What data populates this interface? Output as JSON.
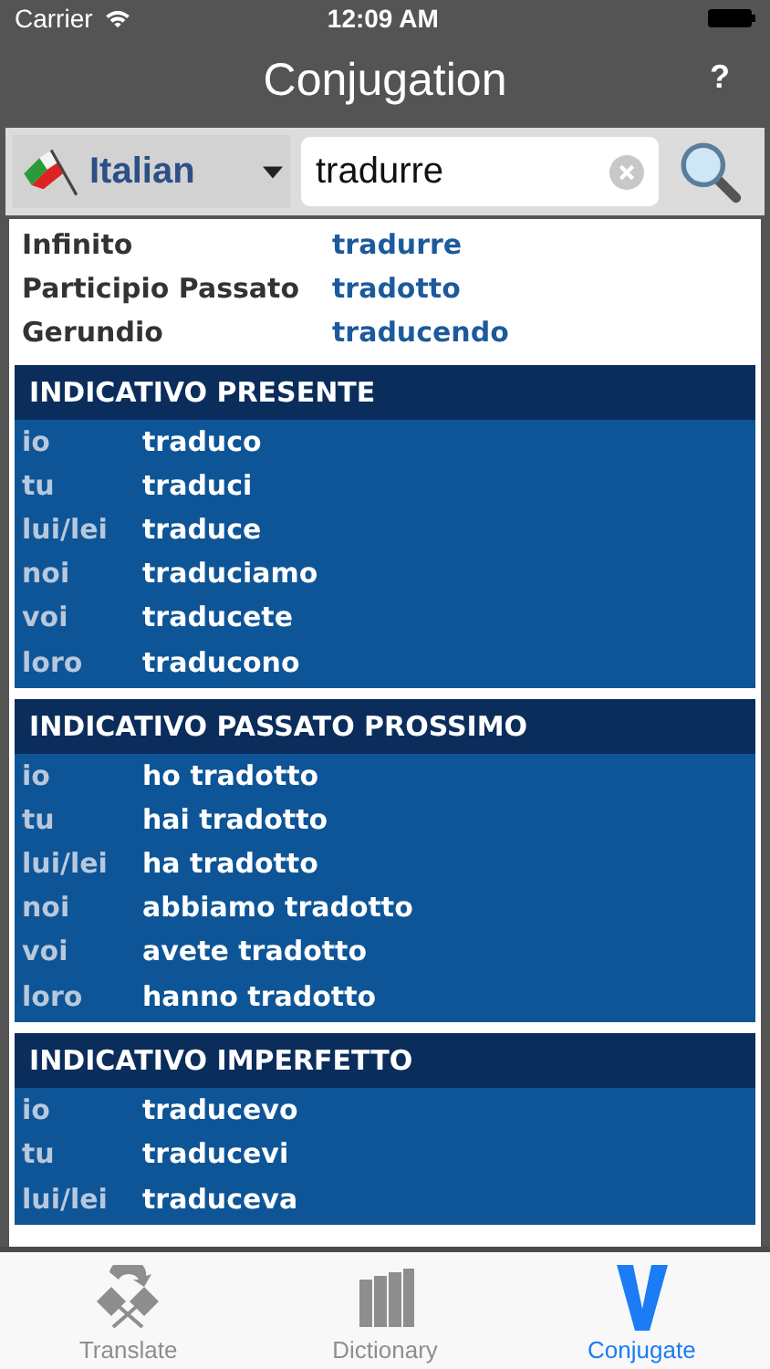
{
  "status_bar": {
    "carrier": "Carrier",
    "time": "12:09 AM"
  },
  "nav": {
    "title": "Conjugation",
    "help": "?"
  },
  "search": {
    "language": "Italian",
    "value": "tradurre"
  },
  "info": [
    {
      "label": "Infinito",
      "value": "tradurre"
    },
    {
      "label": "Participio Passato",
      "value": "tradotto"
    },
    {
      "label": "Gerundio",
      "value": "traducendo"
    }
  ],
  "sections": [
    {
      "title": "INDICATIVO PRESENTE",
      "rows": [
        {
          "pronoun": "io",
          "form": "traduco"
        },
        {
          "pronoun": "tu",
          "form": "traduci"
        },
        {
          "pronoun": "lui/lei",
          "form": "traduce"
        },
        {
          "pronoun": "noi",
          "form": "traduciamo"
        },
        {
          "pronoun": "voi",
          "form": "traducete"
        },
        {
          "pronoun": "loro",
          "form": "traducono"
        }
      ]
    },
    {
      "title": "INDICATIVO PASSATO PROSSIMO",
      "rows": [
        {
          "pronoun": "io",
          "form": "ho tradotto"
        },
        {
          "pronoun": "tu",
          "form": "hai tradotto"
        },
        {
          "pronoun": "lui/lei",
          "form": "ha tradotto"
        },
        {
          "pronoun": "noi",
          "form": "abbiamo tradotto"
        },
        {
          "pronoun": "voi",
          "form": "avete tradotto"
        },
        {
          "pronoun": "loro",
          "form": "hanno tradotto"
        }
      ]
    },
    {
      "title": "INDICATIVO IMPERFETTO",
      "rows": [
        {
          "pronoun": "io",
          "form": "traducevo"
        },
        {
          "pronoun": "tu",
          "form": "traducevi"
        },
        {
          "pronoun": "lui/lei",
          "form": "traduceva"
        }
      ]
    }
  ],
  "tabs": [
    {
      "kind": "translate",
      "label": "Translate",
      "selected": false
    },
    {
      "kind": "dictionary",
      "label": "Dictionary",
      "selected": false
    },
    {
      "kind": "conjugate",
      "label": "Conjugate",
      "selected": true
    }
  ]
}
